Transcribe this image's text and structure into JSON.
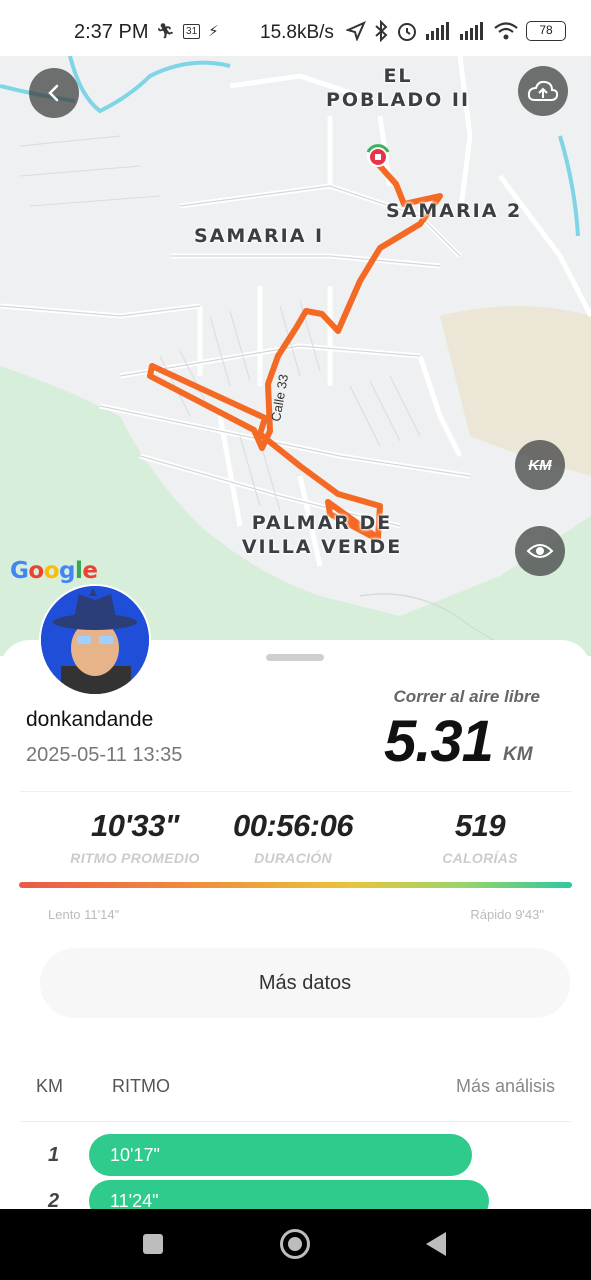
{
  "status_bar": {
    "time": "2:37 PM",
    "calendar_day": "31",
    "net_speed": "15.8kB/s",
    "battery": "78"
  },
  "map": {
    "labels": {
      "el_poblado": "EL\nPOBLADO II",
      "samaria_1": "SAMARIA I",
      "samaria_2": "SAMARIA 2",
      "palmar": "PALMAR DE\nVILLA VERDE",
      "street": "Calle 33"
    },
    "attribution": "Google",
    "km_toggle": "KM",
    "route_color": "#f46a25"
  },
  "profile": {
    "username": "donkandande",
    "datetime": "2025-05-11 13:35"
  },
  "activity": {
    "type": "Correr al aire libre",
    "distance": "5.31",
    "distance_unit": "KM"
  },
  "stats": [
    {
      "value": "10'33\"",
      "label": "RITMO PROMEDIO"
    },
    {
      "value": "00:56:06",
      "label": "DURACIÓN"
    },
    {
      "value": "519",
      "label": "CALORÍAS"
    }
  ],
  "pace_range": {
    "slow": "Lento 11'14\"",
    "fast": "Rápido 9'43\""
  },
  "more_data_button": "Más datos",
  "splits": {
    "col_km": "KM",
    "col_pace": "RITMO",
    "more_analysis": "Más análisis",
    "rows": [
      {
        "km": "1",
        "pace": "10'17\"",
        "fill": 0.71
      },
      {
        "km": "2",
        "pace": "11'24\"",
        "fill": 0.74
      }
    ],
    "bar_color": "#2ecb8c"
  }
}
